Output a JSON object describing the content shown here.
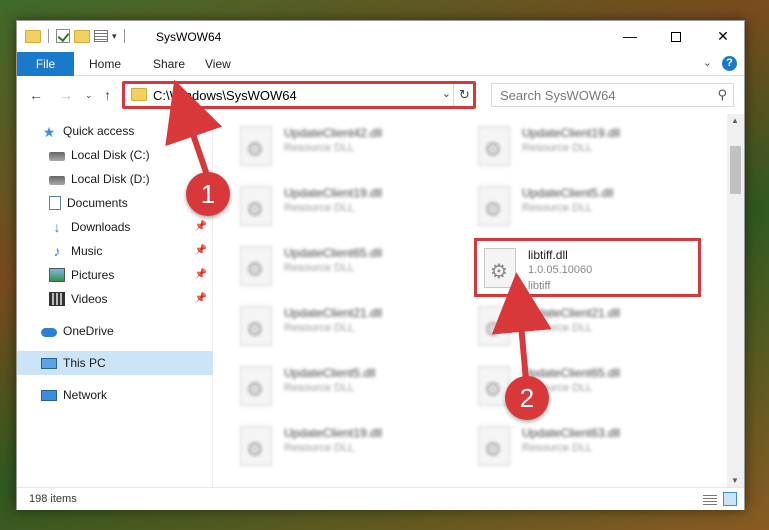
{
  "window": {
    "title": "SysWOW64",
    "minimize": "—",
    "close": "✕"
  },
  "ribbon": {
    "file": "File",
    "home": "Home",
    "share": "Share",
    "view": "View"
  },
  "nav": {
    "back": "←",
    "forward": "→",
    "recent": "⌄",
    "up": "↑"
  },
  "address": {
    "path": "C:\\Windows\\SysWOW64",
    "dropdown": "⌄",
    "refresh": "↻"
  },
  "search": {
    "placeholder": "Search SysWOW64",
    "icon": "⚲"
  },
  "sidebar": {
    "items": [
      {
        "label": "Quick access",
        "icon": "star-icon"
      },
      {
        "label": "Local Disk (C:)",
        "icon": "drive-icon"
      },
      {
        "label": "Local Disk (D:)",
        "icon": "drive-icon"
      },
      {
        "label": "Documents",
        "icon": "document-icon",
        "pinned": true
      },
      {
        "label": "Downloads",
        "icon": "download-icon",
        "pinned": true
      },
      {
        "label": "Music",
        "icon": "music-icon",
        "pinned": true
      },
      {
        "label": "Pictures",
        "icon": "pictures-icon",
        "pinned": true
      },
      {
        "label": "Videos",
        "icon": "videos-icon",
        "pinned": true
      },
      {
        "label": "OneDrive",
        "icon": "cloud-icon"
      },
      {
        "label": "This PC",
        "icon": "computer-icon",
        "selected": true
      },
      {
        "label": "Network",
        "icon": "network-icon"
      }
    ],
    "pin_glyph": "📌"
  },
  "files": [
    {
      "name": "UpdateClient42.dll",
      "type": "Resource DLL"
    },
    {
      "name": "UpdateClient19.dll",
      "type": "Resource DLL"
    },
    {
      "name": "UpdateClient19.dll",
      "type": "Resource DLL"
    },
    {
      "name": "UpdateClient5.dll",
      "type": "Resource DLL"
    },
    {
      "name": "UpdateClient65.dll",
      "type": "Resource DLL"
    },
    {
      "name": "libtiff.dll",
      "version": "1.0.05.10060",
      "type": "libtiff"
    },
    {
      "name": "UpdateClient21.dll",
      "type": "Resource DLL"
    },
    {
      "name": "UpdateClient21.dll",
      "type": "Resource DLL"
    },
    {
      "name": "UpdateClient5.dll",
      "type": "Resource DLL"
    },
    {
      "name": "UpdateClient65.dll",
      "type": "Resource DLL"
    },
    {
      "name": "UpdateClient19.dll",
      "type": "Resource DLL"
    },
    {
      "name": "UpdateClient63.dll",
      "type": "Resource DLL"
    }
  ],
  "status": {
    "count": "198 items"
  },
  "annotations": {
    "step1": "1",
    "step2": "2",
    "color": "#d9383a"
  },
  "colors": {
    "accent": "#1979ca",
    "selection": "#cce4f7"
  }
}
